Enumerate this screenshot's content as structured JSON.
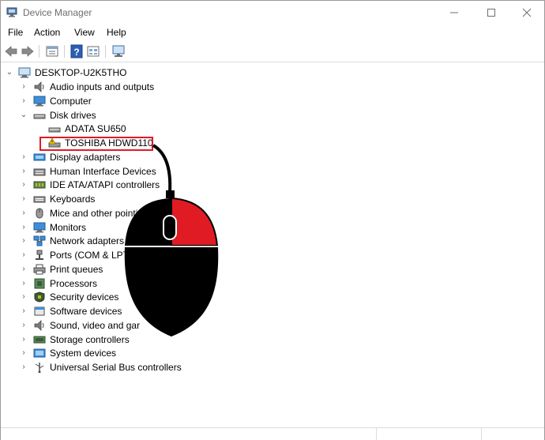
{
  "window": {
    "title": "Device Manager"
  },
  "window_controls": {
    "minimize": "—",
    "maximize": "☐",
    "close": "✕"
  },
  "menu": [
    "File",
    "Action",
    "View",
    "Help"
  ],
  "toolbar": [
    "back-icon",
    "forward-icon",
    "properties-icon",
    "help-icon",
    "details-icon",
    "monitor-icon"
  ],
  "tree": {
    "root": "DESKTOP-U2K5THO",
    "items": [
      {
        "label": "Audio inputs and outputs",
        "icon": "speaker-icon",
        "expanded": false
      },
      {
        "label": "Computer",
        "icon": "computer-icon",
        "expanded": false
      },
      {
        "label": "Disk drives",
        "icon": "disk-drive-icon",
        "expanded": true
      },
      {
        "label": "ADATA SU650",
        "icon": "disk-drive-icon",
        "child": true
      },
      {
        "label": "TOSHIBA HDWD110",
        "icon": "disk-drive-warning-icon",
        "child": true,
        "highlighted": true
      },
      {
        "label": "Display adapters",
        "icon": "display-adapter-icon",
        "expanded": false
      },
      {
        "label": "Human Interface Devices",
        "icon": "hid-icon",
        "expanded": false
      },
      {
        "label": "IDE ATA/ATAPI controllers",
        "icon": "ide-controller-icon",
        "expanded": false
      },
      {
        "label": "Keyboards",
        "icon": "keyboard-icon",
        "expanded": false
      },
      {
        "label": "Mice and other pointin",
        "icon": "mouse-icon",
        "expanded": false
      },
      {
        "label": "Monitors",
        "icon": "monitor-icon",
        "expanded": false
      },
      {
        "label": "Network adapters",
        "icon": "network-adapter-icon",
        "expanded": false
      },
      {
        "label": "Ports (COM & LPT",
        "icon": "port-icon",
        "expanded": false
      },
      {
        "label": "Print queues",
        "icon": "printer-icon",
        "expanded": false
      },
      {
        "label": "Processors",
        "icon": "processor-icon",
        "expanded": false
      },
      {
        "label": "Security devices",
        "icon": "security-icon",
        "expanded": false
      },
      {
        "label": "Software devices",
        "icon": "software-icon",
        "expanded": false
      },
      {
        "label": "Sound, video and gar",
        "icon": "sound-icon",
        "expanded": false
      },
      {
        "label": "Storage controllers",
        "icon": "storage-controller-icon",
        "expanded": false
      },
      {
        "label": "System devices",
        "icon": "system-devices-icon",
        "expanded": false
      },
      {
        "label": "Universal Serial Bus controllers",
        "icon": "usb-icon",
        "expanded": false
      }
    ]
  },
  "overlay": {
    "mouse_illustration": "mouse-right-click-icon",
    "highlight_color": "#e01b24"
  }
}
